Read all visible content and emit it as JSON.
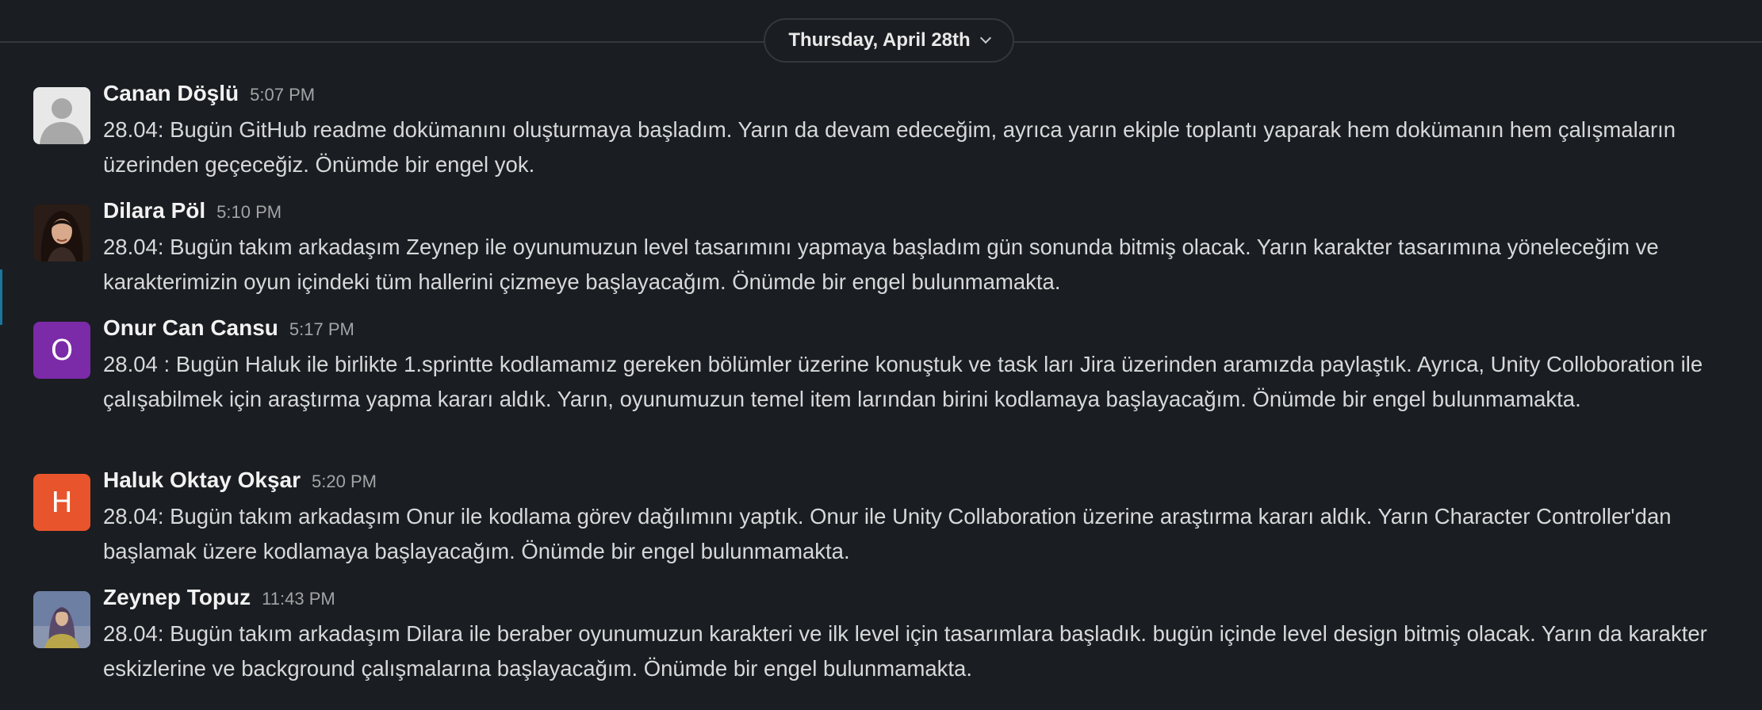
{
  "date_divider": {
    "label": "Thursday, April 28th",
    "icon": "chevron-down-icon"
  },
  "colors": {
    "background": "#1a1d21",
    "divider": "#35373b",
    "onur_avatar": "#7b2aa8",
    "haluk_avatar": "#e8542b",
    "canan_avatar": "#e8e8e8"
  },
  "messages": [
    {
      "sender": "Canan Döşlü",
      "time": "5:07 PM",
      "text": "28.04: Bugün GitHub readme dokümanını oluşturmaya başladım. Yarın da devam edeceğim, ayrıca yarın ekiple toplantı yaparak hem dokümanın hem çalışmaların üzerinden geçeceğiz. Önümde bir engel yok.",
      "avatar": "default-user-avatar"
    },
    {
      "sender": "Dilara Pöl",
      "time": "5:10 PM",
      "text": "28.04: Bugün takım arkadaşım Zeynep ile oyunumuzun level tasarımını yapmaya başladım gün sonunda bitmiş olacak. Yarın karakter tasarımına yöneleceğim ve karakterimizin oyun içindeki tüm hallerini çizmeye başlayacağım. Önümde bir engel bulunmamakta.",
      "avatar": "photo-avatar"
    },
    {
      "sender": "Onur Can Cansu",
      "time": "5:17 PM",
      "text": "28.04 : Bugün Haluk ile birlikte 1.sprintte kodlamamız gereken bölümler üzerine konuştuk ve task ları Jira üzerinden aramızda paylaştık. Ayrıca, Unity Colloboration ile çalışabilmek için araştırma yapma kararı aldık. Yarın, oyunumuzun temel item larından birini kodlamaya başlayacağım. Önümde bir engel bulunmamakta.",
      "avatar_letter": "O"
    },
    {
      "sender": "Haluk Oktay Okşar",
      "time": "5:20 PM",
      "text": "28.04: Bugün takım arkadaşım Onur ile kodlama görev dağılımını yaptık. Onur ile Unity Collaboration üzerine araştırma kararı aldık. Yarın Character Controller'dan başlamak üzere kodlamaya başlayacağım. Önümde bir engel bulunmamakta.",
      "avatar_letter": "H"
    },
    {
      "sender": "Zeynep Topuz",
      "time": "11:43 PM",
      "text": "28.04: Bugün takım arkadaşım Dilara ile beraber oyunumuzun karakteri ve ilk level için tasarımlara başladık. bugün içinde level design bitmiş olacak. Yarın da karakter eskizlerine ve background çalışmalarına başlayacağım. Önümde bir engel bulunmamakta.",
      "avatar": "photo-avatar"
    }
  ]
}
